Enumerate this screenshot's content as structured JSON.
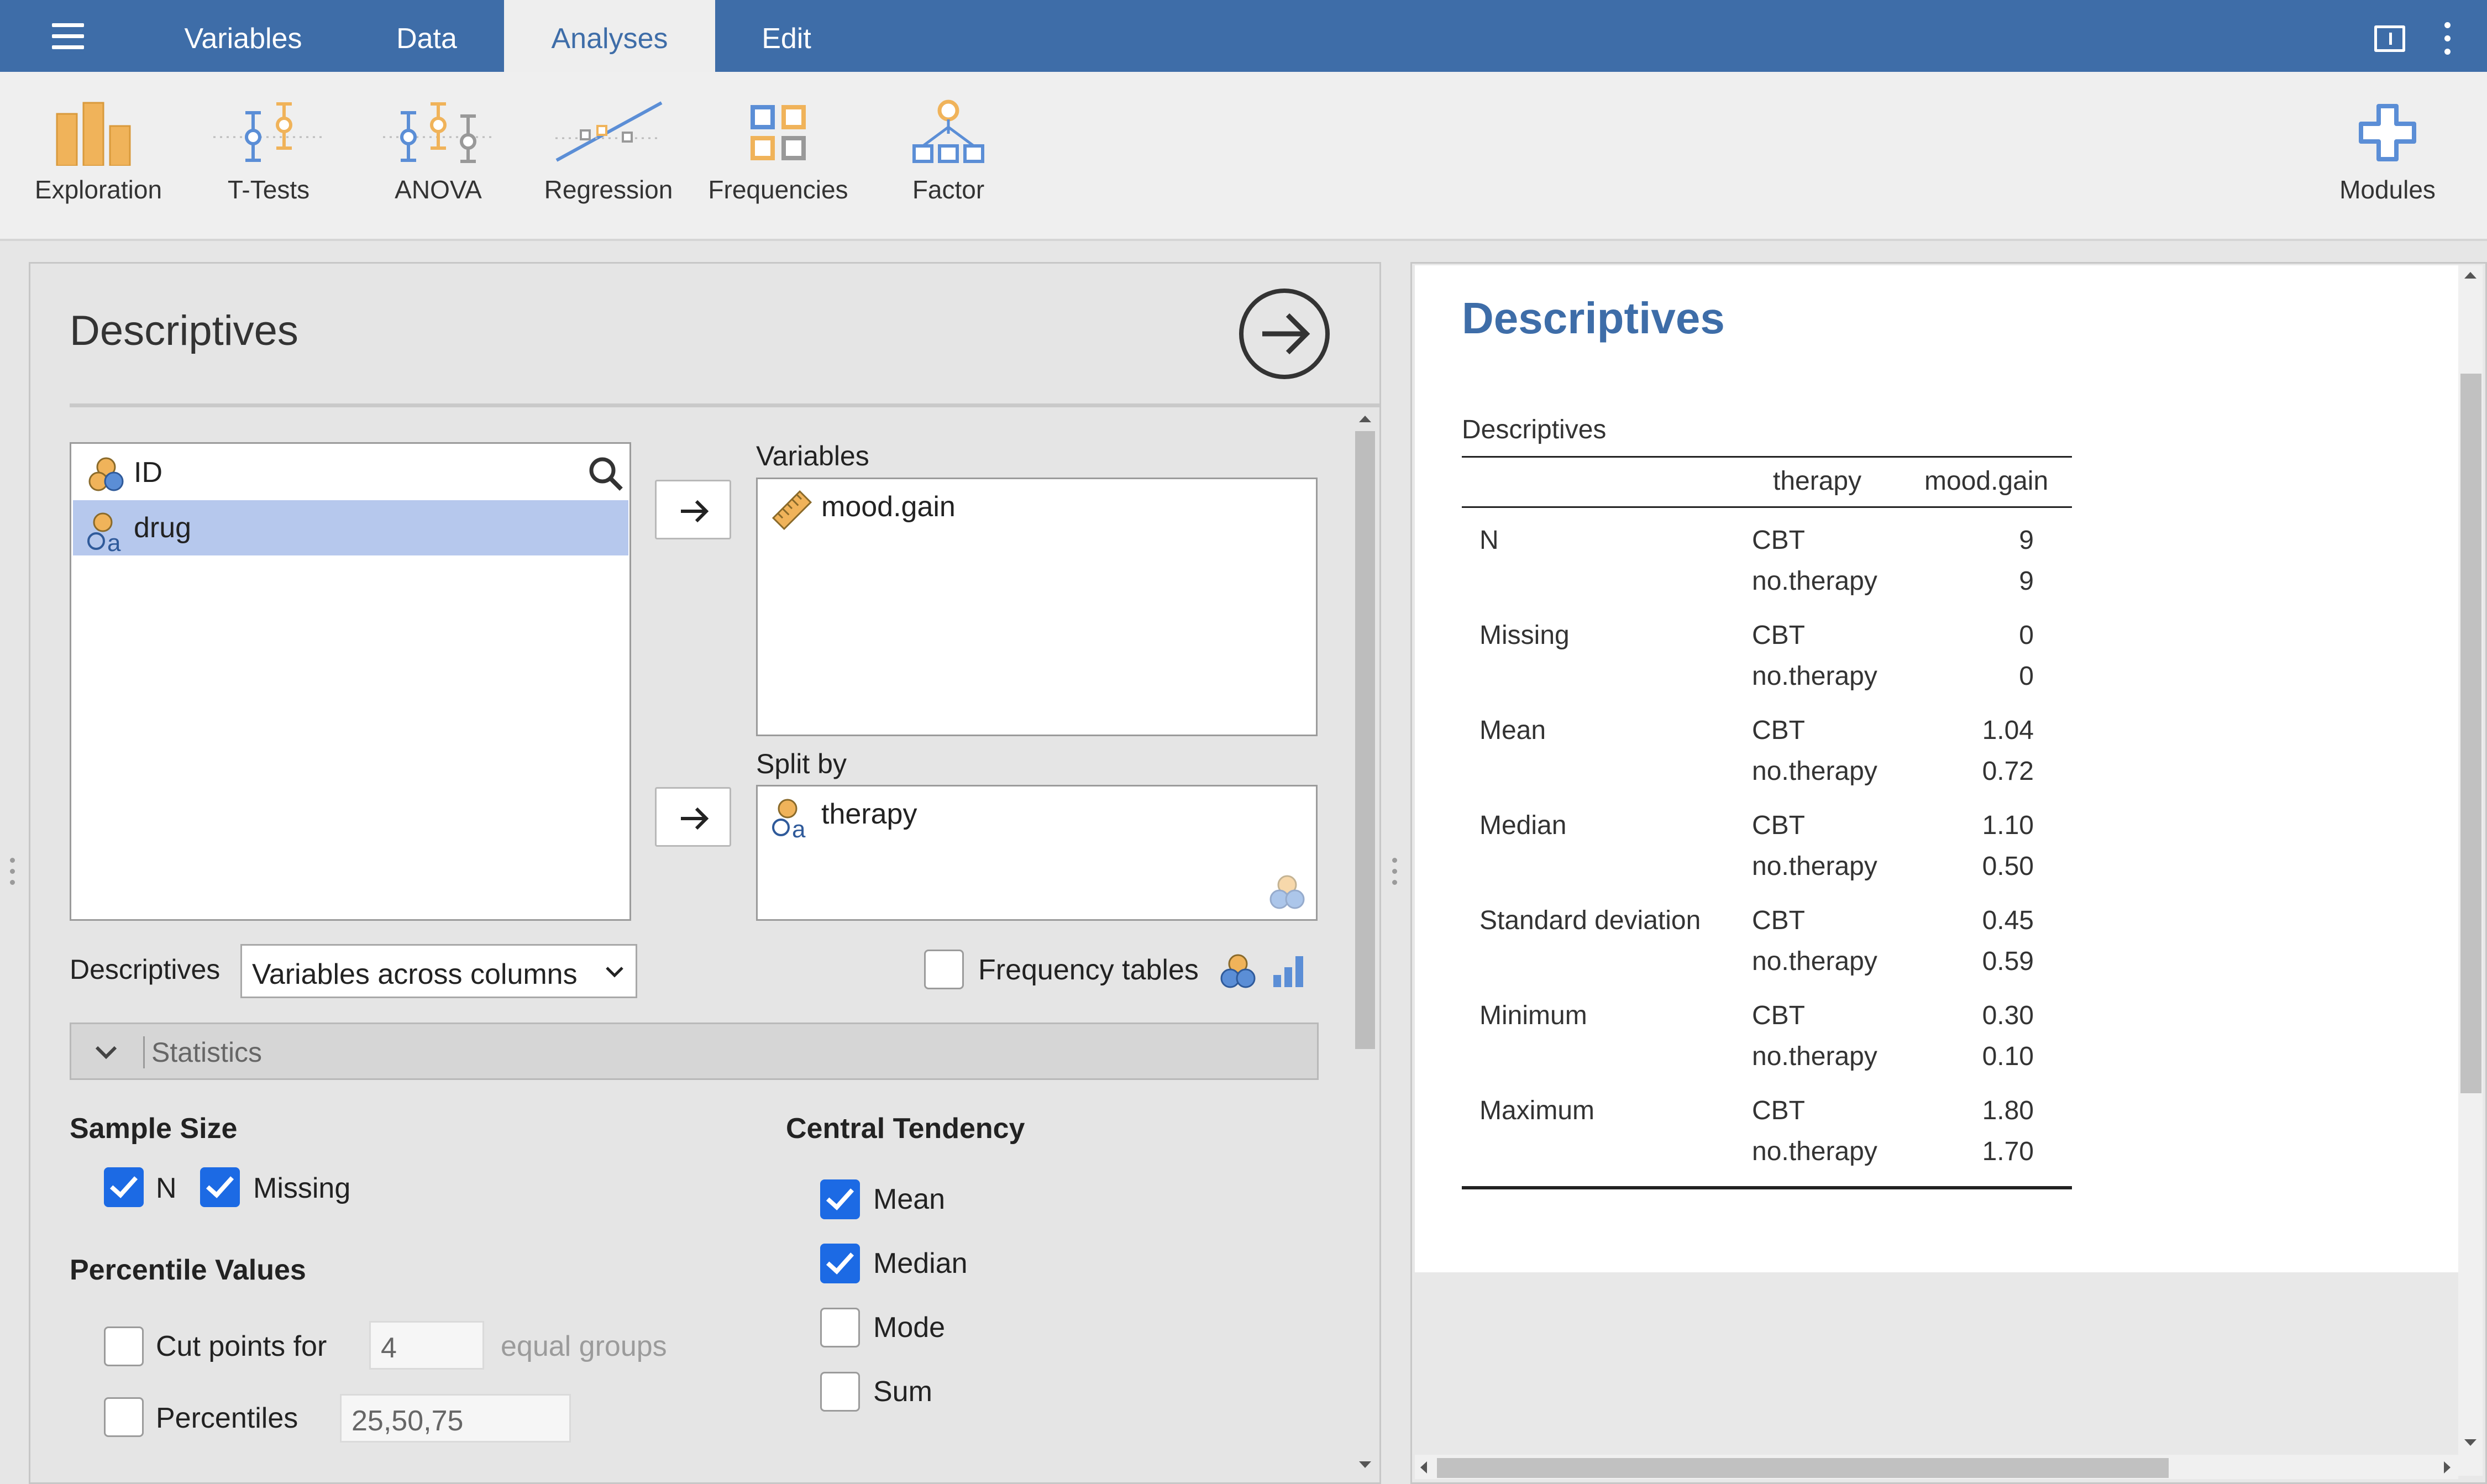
{
  "tabs": [
    {
      "label": "Variables",
      "active": false
    },
    {
      "label": "Data",
      "active": false
    },
    {
      "label": "Analyses",
      "active": true
    },
    {
      "label": "Edit",
      "active": false
    }
  ],
  "toolbar": {
    "items": [
      "Exploration",
      "T-Tests",
      "ANOVA",
      "Regression",
      "Frequencies",
      "Factor"
    ],
    "modules_label": "Modules"
  },
  "colors": {
    "accent": "#3e6da8",
    "toolbar_icon_blue": "#5b8ed6",
    "toolbar_icon_orange": "#f0b35a",
    "checkbox_on": "#1c6ae4"
  },
  "analysis": {
    "title": "Descriptives",
    "source_variables": [
      {
        "name": "ID",
        "icon": "nominal-icon",
        "selected": false
      },
      {
        "name": "drug",
        "icon": "nominal-text-icon",
        "selected": true
      }
    ],
    "variables_label": "Variables",
    "variables": [
      "mood.gain"
    ],
    "split_by_label": "Split by",
    "split_by": [
      "therapy"
    ],
    "descriptives_label": "Descriptives",
    "descriptives_option": "Variables across columns",
    "frequency_tables_label": "Frequency tables",
    "statistics_label": "Statistics",
    "sample_size": {
      "heading": "Sample Size",
      "n_label": "N",
      "missing_label": "Missing"
    },
    "percentiles": {
      "heading": "Percentile Values",
      "cut_points_label": "Cut points for",
      "cut_points_value": "4",
      "equal_groups_label": "equal groups",
      "percentiles_label": "Percentiles",
      "percentiles_value": "25,50,75"
    },
    "central_tendency": {
      "heading": "Central Tendency",
      "mean": "Mean",
      "median": "Median",
      "mode": "Mode",
      "sum": "Sum"
    }
  },
  "results": {
    "title": "Descriptives",
    "table_title": "Descriptives",
    "columns": [
      "therapy",
      "mood.gain"
    ],
    "rows": [
      {
        "stat": "N",
        "cbt_label": "CBT",
        "cbt": "9",
        "no_label": "no.therapy",
        "no": "9"
      },
      {
        "stat": "Missing",
        "cbt_label": "CBT",
        "cbt": "0",
        "no_label": "no.therapy",
        "no": "0"
      },
      {
        "stat": "Mean",
        "cbt_label": "CBT",
        "cbt": "1.04",
        "no_label": "no.therapy",
        "no": "0.72"
      },
      {
        "stat": "Median",
        "cbt_label": "CBT",
        "cbt": "1.10",
        "no_label": "no.therapy",
        "no": "0.50"
      },
      {
        "stat": "Standard deviation",
        "cbt_label": "CBT",
        "cbt": "0.45",
        "no_label": "no.therapy",
        "no": "0.59"
      },
      {
        "stat": "Minimum",
        "cbt_label": "CBT",
        "cbt": "0.30",
        "no_label": "no.therapy",
        "no": "0.10"
      },
      {
        "stat": "Maximum",
        "cbt_label": "CBT",
        "cbt": "1.80",
        "no_label": "no.therapy",
        "no": "1.70"
      }
    ]
  }
}
